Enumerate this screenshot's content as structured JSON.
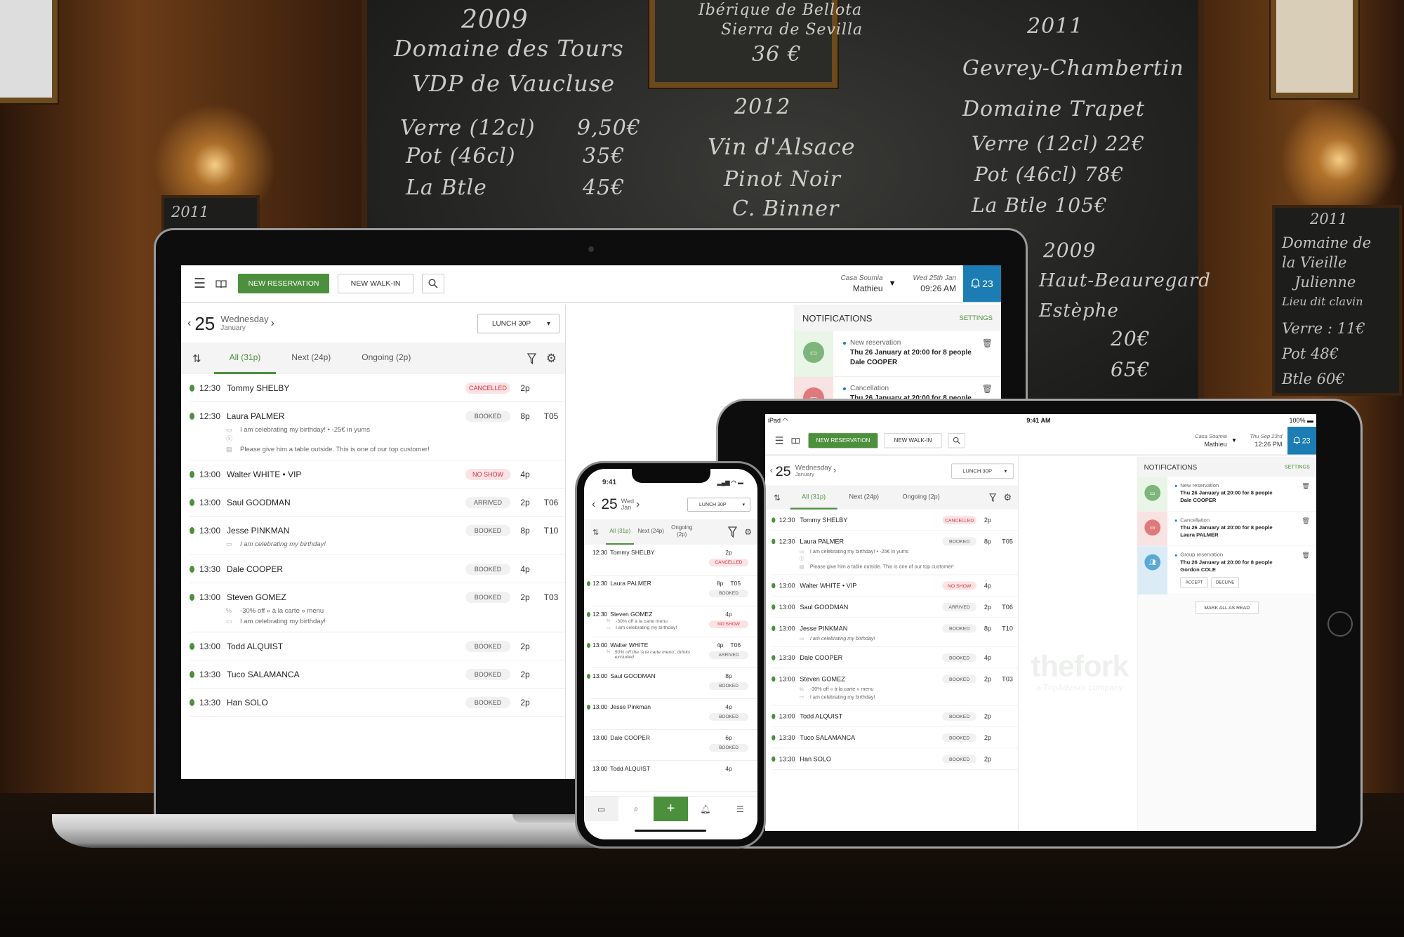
{
  "chalkboard": {
    "main": [
      "2009",
      "Domaine des Tours",
      "VDP de Vaucluse",
      "Verre (12cl)",
      "9,50€",
      "Pot (46cl)",
      "35€",
      "La Btle",
      "45€",
      "Ibérique de Bellota",
      "Sierra de Sevilla",
      "36 €",
      "2012",
      "Vin d'Alsace",
      "Pinot Noir",
      "C. Binner",
      "2011",
      "Gevrey-Chambertin",
      "Domaine Trapet",
      "Verre (12cl)  22€",
      "Pot (46cl)  78€",
      "La Btle  105€",
      "2009",
      "Haut-Beauregard",
      "Estèphe",
      "20€",
      "65€"
    ],
    "right_board": [
      "2011",
      "Domaine de",
      "la Vieille",
      "Julienne",
      "Lieu dit clavin",
      "Verre : 11€",
      "Pot  48€",
      "Btle  60€"
    ],
    "left_board": [
      "2011"
    ]
  },
  "app": {
    "toolbar": {
      "new_reservation": "NEW RESERVATION",
      "new_walkin": "NEW WALK-IN"
    },
    "restaurant": "Casa Soumia",
    "user": "Mathieu",
    "laptop_clock": {
      "date": "Wed 25th Jan",
      "time": "09:26 AM"
    },
    "tablet_clock": {
      "date": "Thu Sep 23rd",
      "time": "12:26 PM"
    },
    "notification_count": "23",
    "date": {
      "day": "25",
      "weekday": "Wednesday",
      "month": "January",
      "weekday_short": "Wed",
      "month_short": "Jan"
    },
    "service": "LUNCH 30P",
    "tabs": [
      {
        "label": "All (31p)",
        "active": true
      },
      {
        "label": "Next (24p)",
        "active": false
      },
      {
        "label": "Ongoing (2p)",
        "active": false
      }
    ],
    "reservations": [
      {
        "time": "12:30",
        "name": "Tommy SHELBY",
        "status": "CANCELLED",
        "people": "2p",
        "table": "",
        "online": true
      },
      {
        "time": "12:30",
        "name": "Laura PALMER",
        "status": "BOOKED",
        "people": "8p",
        "table": "T05",
        "online": true,
        "notes": [
          {
            "icon": "comment-offer",
            "text": "I am celebrating my birthday! • -25€ in yums"
          },
          {
            "icon": "note",
            "text": "Please give him a table outside. This is one of our top customer!"
          }
        ]
      },
      {
        "time": "13:00",
        "name": "Walter WHITE • VIP",
        "status": "NO SHOW",
        "people": "4p",
        "table": "",
        "online": true
      },
      {
        "time": "13:00",
        "name": "Saul GOODMAN",
        "status": "ARRIVED",
        "people": "2p",
        "table": "T06",
        "online": true
      },
      {
        "time": "13:00",
        "name": "Jesse PINKMAN",
        "status": "BOOKED",
        "people": "8p",
        "table": "T10",
        "online": true,
        "notes": [
          {
            "icon": "comment",
            "text": "I am celebrating my birthday!",
            "italic": true
          }
        ]
      },
      {
        "time": "13:30",
        "name": "Dale COOPER",
        "status": "BOOKED",
        "people": "4p",
        "table": "",
        "online": true
      },
      {
        "time": "13:00",
        "name": "Steven GOMEZ",
        "status": "BOOKED",
        "people": "2p",
        "table": "T03",
        "online": true,
        "notes": [
          {
            "icon": "offer",
            "text": "-30% off « à la carte » menu"
          },
          {
            "icon": "comment",
            "text": "I am celebrating my birthday!"
          }
        ]
      },
      {
        "time": "13:00",
        "name": "Todd ALQUIST",
        "status": "BOOKED",
        "people": "2p",
        "table": "",
        "online": true
      },
      {
        "time": "13:30",
        "name": "Tuco SALAMANCA",
        "status": "BOOKED",
        "people": "2p",
        "table": "",
        "online": true
      },
      {
        "time": "13:30",
        "name": "Han SOLO",
        "status": "BOOKED",
        "people": "2p",
        "table": "",
        "online": true
      }
    ],
    "notifications": {
      "title": "NOTIFICATIONS",
      "settings": "SETTINGS",
      "items": [
        {
          "type": "new",
          "title": "New reservation",
          "detail": "Thu 26 January at 20:00 for 8 people",
          "guest": "Dale COOPER",
          "strip": "#e9f5e7",
          "circle": "#7db57a"
        },
        {
          "type": "cancel",
          "title": "Cancellation",
          "detail": "Thu 26 January at 20:00 for 8 people",
          "guest": "Laura PALMER",
          "strip": "#f9e2e2",
          "circle": "#e07a7a"
        },
        {
          "type": "group",
          "title": "Group reservation",
          "detail": "Thu 26 January at 20:00 for 8 people",
          "guest": "Gordon COLE",
          "strip": "#dcecf6",
          "circle": "#5aa8d4",
          "accept": "ACCEPT",
          "decline": "DECLINE"
        }
      ],
      "mark_all": "MARK ALL AS READ"
    }
  },
  "tablet": {
    "device": "iPad",
    "time": "9:41 AM",
    "battery": "100%"
  },
  "watermark": {
    "brand": "thefork",
    "tagline": "a TripAdvisor company"
  },
  "phone": {
    "time": "9:41",
    "reservations": [
      {
        "time": "12:30",
        "name": "Tommy SHELBY",
        "people": "2p",
        "table": "",
        "status": "CANCELLED",
        "online": false
      },
      {
        "time": "12:30",
        "name": "Laura PALMER",
        "people": "8p",
        "table": "T05",
        "status": "BOOKED",
        "online": true
      },
      {
        "time": "12:30",
        "name": "Steven GOMEZ",
        "people": "4p",
        "table": "",
        "status": "NO SHOW",
        "online": true,
        "notes": [
          {
            "icon": "offer",
            "text": "-30% off à la carte menu"
          },
          {
            "icon": "comment",
            "text": "I am celebrating my birthday!"
          }
        ]
      },
      {
        "time": "13:00",
        "name": "Walter WHITE",
        "people": "4p",
        "table": "T06",
        "status": "ARRIVED",
        "online": true,
        "notes": [
          {
            "icon": "offer",
            "text": "50% off the 'à la carte menu', drinks excluded",
            "italic": true
          }
        ]
      },
      {
        "time": "13:00",
        "name": "Saul GOODMAN",
        "people": "8p",
        "table": "",
        "status": "BOOKED",
        "online": true
      },
      {
        "time": "13:00",
        "name": "Jesse Pinkman",
        "people": "4p",
        "table": "",
        "status": "BOOKED",
        "online": true
      },
      {
        "time": "13:00",
        "name": "Dale COOPER",
        "people": "6p",
        "table": "",
        "status": "BOOKED",
        "online": false
      },
      {
        "time": "13:00",
        "name": "Todd ALQUIST",
        "people": "4p",
        "table": "",
        "status": "",
        "online": false
      }
    ]
  },
  "colors": {
    "brand_green": "#4c8f3c",
    "notification_blue": "#1b7db3",
    "alert_red": "#d0323c"
  }
}
